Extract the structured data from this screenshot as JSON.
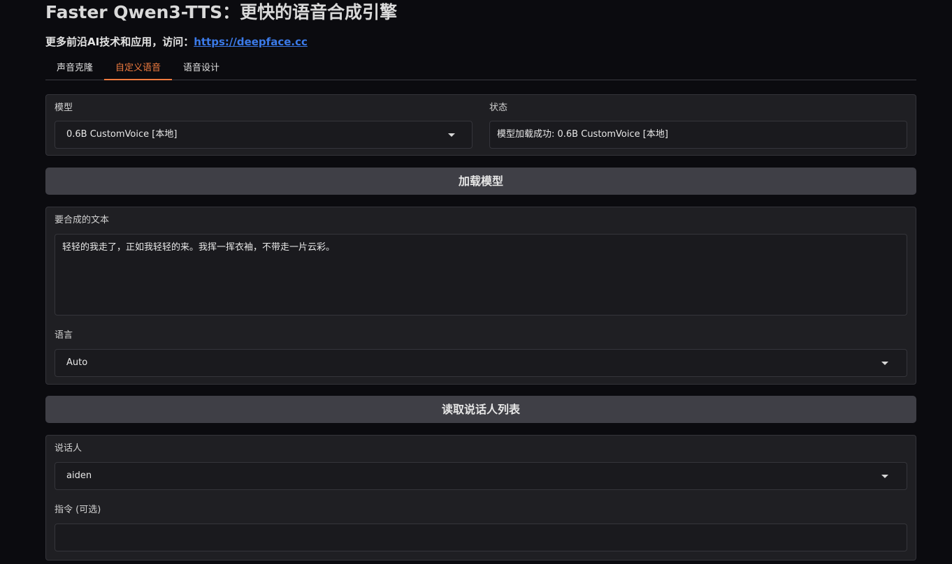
{
  "header": {
    "title": "Faster Qwen3-TTS：更快的语音合成引擎",
    "subtitle_prefix": "更多前沿AI技术和应用，访问：",
    "subtitle_link": "https://deepface.cc"
  },
  "tabs": [
    {
      "label": "声音克隆",
      "active": false
    },
    {
      "label": "自定义语音",
      "active": true
    },
    {
      "label": "语音设计",
      "active": false
    }
  ],
  "model_panel": {
    "model_label": "模型",
    "model_value": "0.6B CustomVoice [本地]",
    "status_label": "状态",
    "status_value": "模型加载成功: 0.6B CustomVoice [本地]"
  },
  "load_button": {
    "label": "加载模型"
  },
  "text_panel": {
    "text_label": "要合成的文本",
    "text_value": "轻轻的我走了，正如我轻轻的来。我挥一挥衣袖，不带走一片云彩。",
    "language_label": "语言",
    "language_value": "Auto"
  },
  "speakers_button": {
    "label": "读取说话人列表"
  },
  "speaker_panel": {
    "speaker_label": "说话人",
    "speaker_value": "aiden",
    "instruction_label": "指令 (可选)",
    "instruction_value": ""
  },
  "colors": {
    "background": "#0b0b0f",
    "panel": "#1f1f23",
    "accent": "#f07b3f",
    "link": "#3b7ae8",
    "button": "#3f3f46"
  }
}
